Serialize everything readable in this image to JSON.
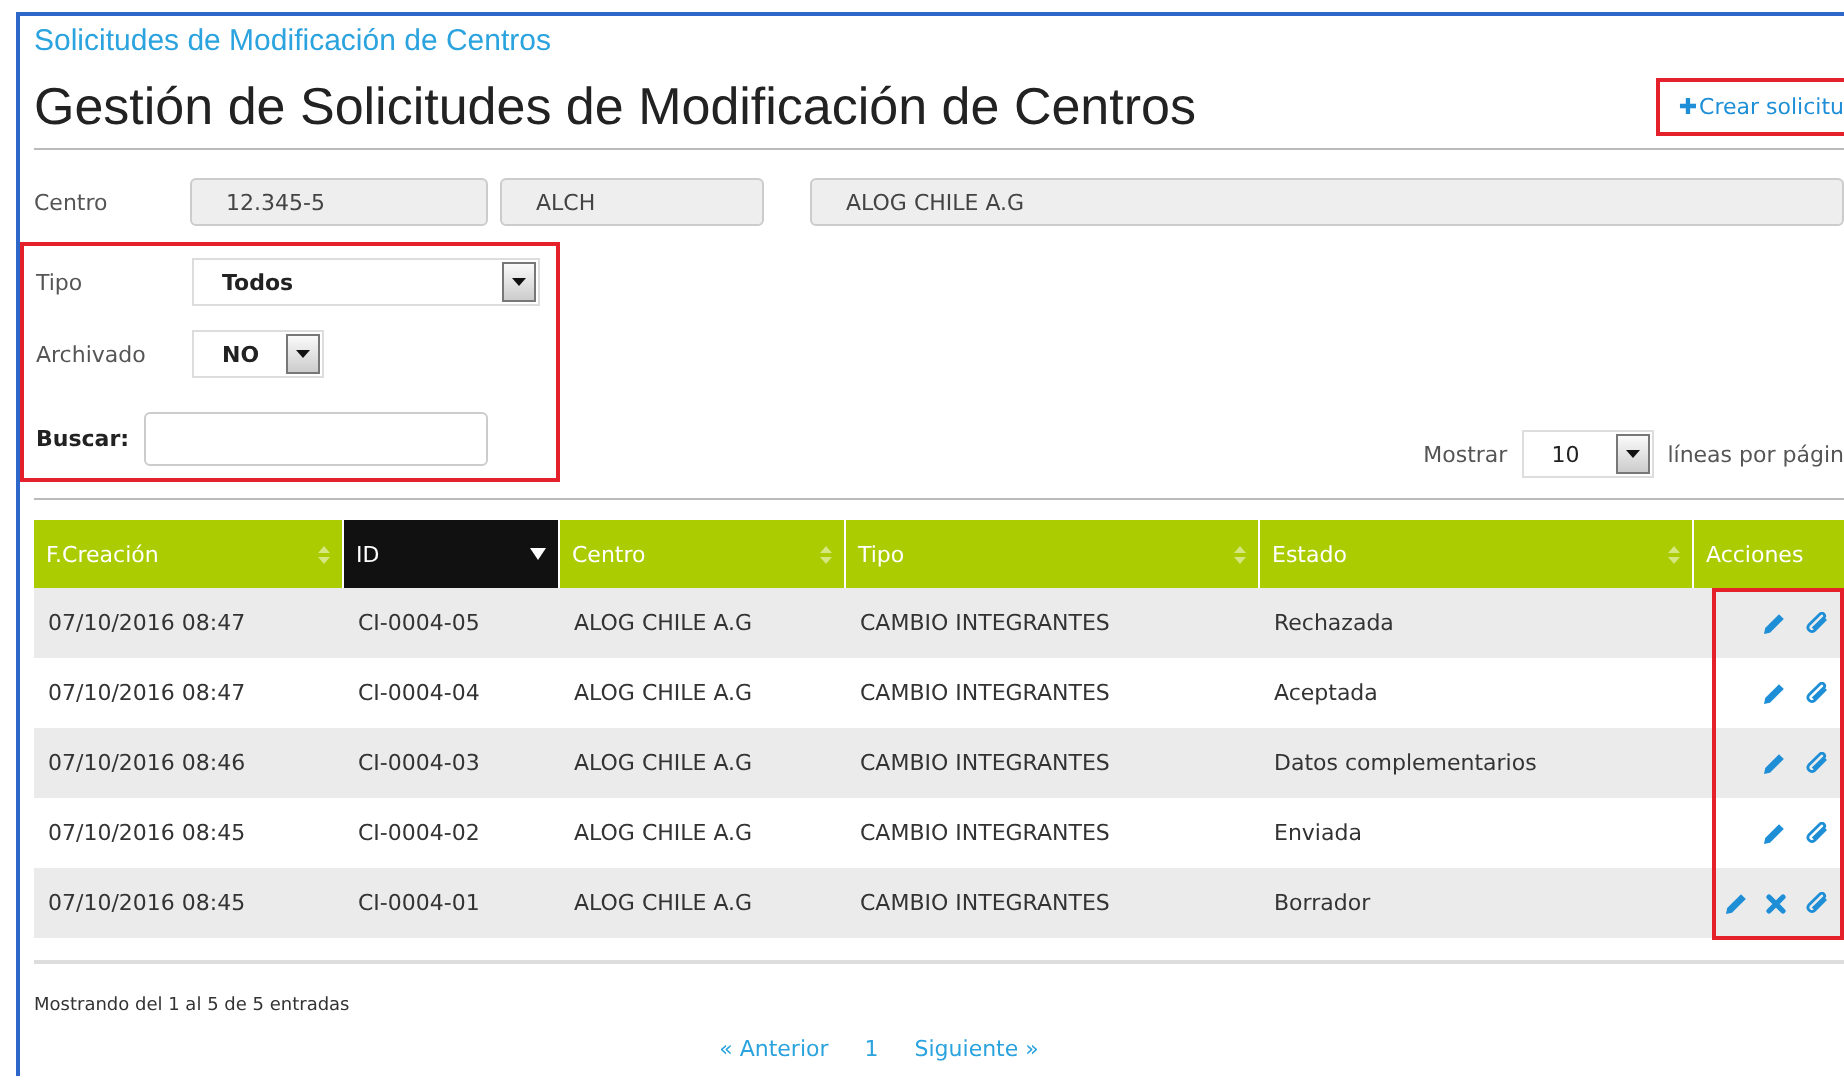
{
  "breadcrumb": "Solicitudes de Modificación de Centros",
  "title": "Gestión de Solicitudes de Modificación de Centros",
  "create_button": {
    "icon": "✚",
    "label": "Crear solicitu",
    "highlighted": true
  },
  "centro": {
    "label": "Centro",
    "fields": [
      "12.345-5",
      "ALCH",
      "ALOG CHILE A.G"
    ]
  },
  "filters": {
    "highlighted": true,
    "tipo": {
      "label": "Tipo",
      "value": "Todos"
    },
    "archivado": {
      "label": "Archivado",
      "value": "NO"
    },
    "buscar": {
      "label": "Buscar:"
    }
  },
  "page_length": {
    "label": "Mostrar",
    "value": "10",
    "suffix": "líneas por págin"
  },
  "table": {
    "columns": [
      {
        "label": "F.Creación",
        "sorted": false
      },
      {
        "label": "ID",
        "sorted": true
      },
      {
        "label": "Centro",
        "sorted": false
      },
      {
        "label": "Tipo",
        "sorted": false
      },
      {
        "label": "Estado",
        "sorted": false
      },
      {
        "label": "Acciones",
        "sortable": false
      }
    ],
    "actions_highlighted": true,
    "rows": [
      {
        "cells": [
          "07/10/2016 08:47",
          "CI-0004-05",
          "ALOG CHILE A.G",
          "CAMBIO INTEGRANTES",
          "Rechazada"
        ],
        "actions": [
          {
            "kind": "edit"
          },
          {
            "kind": "attach"
          }
        ]
      },
      {
        "cells": [
          "07/10/2016 08:47",
          "CI-0004-04",
          "ALOG CHILE A.G",
          "CAMBIO INTEGRANTES",
          "Aceptada"
        ],
        "actions": [
          {
            "kind": "edit"
          },
          {
            "kind": "attach"
          }
        ]
      },
      {
        "cells": [
          "07/10/2016 08:46",
          "CI-0004-03",
          "ALOG CHILE A.G",
          "CAMBIO INTEGRANTES",
          "Datos complementarios"
        ],
        "actions": [
          {
            "kind": "edit"
          },
          {
            "kind": "attach"
          }
        ]
      },
      {
        "cells": [
          "07/10/2016 08:45",
          "CI-0004-02",
          "ALOG CHILE A.G",
          "CAMBIO INTEGRANTES",
          "Enviada"
        ],
        "actions": [
          {
            "kind": "edit"
          },
          {
            "kind": "attach"
          }
        ]
      },
      {
        "cells": [
          "07/10/2016 08:45",
          "CI-0004-01",
          "ALOG CHILE A.G",
          "CAMBIO INTEGRANTES",
          "Borrador"
        ],
        "actions": [
          {
            "kind": "edit"
          },
          {
            "kind": "delete"
          },
          {
            "kind": "attach"
          }
        ]
      }
    ]
  },
  "info": "Mostrando del 1 al 5 de 5 entradas",
  "pagination": {
    "previous": "« Anterior",
    "pages": [
      "1"
    ],
    "next": "Siguiente »"
  }
}
